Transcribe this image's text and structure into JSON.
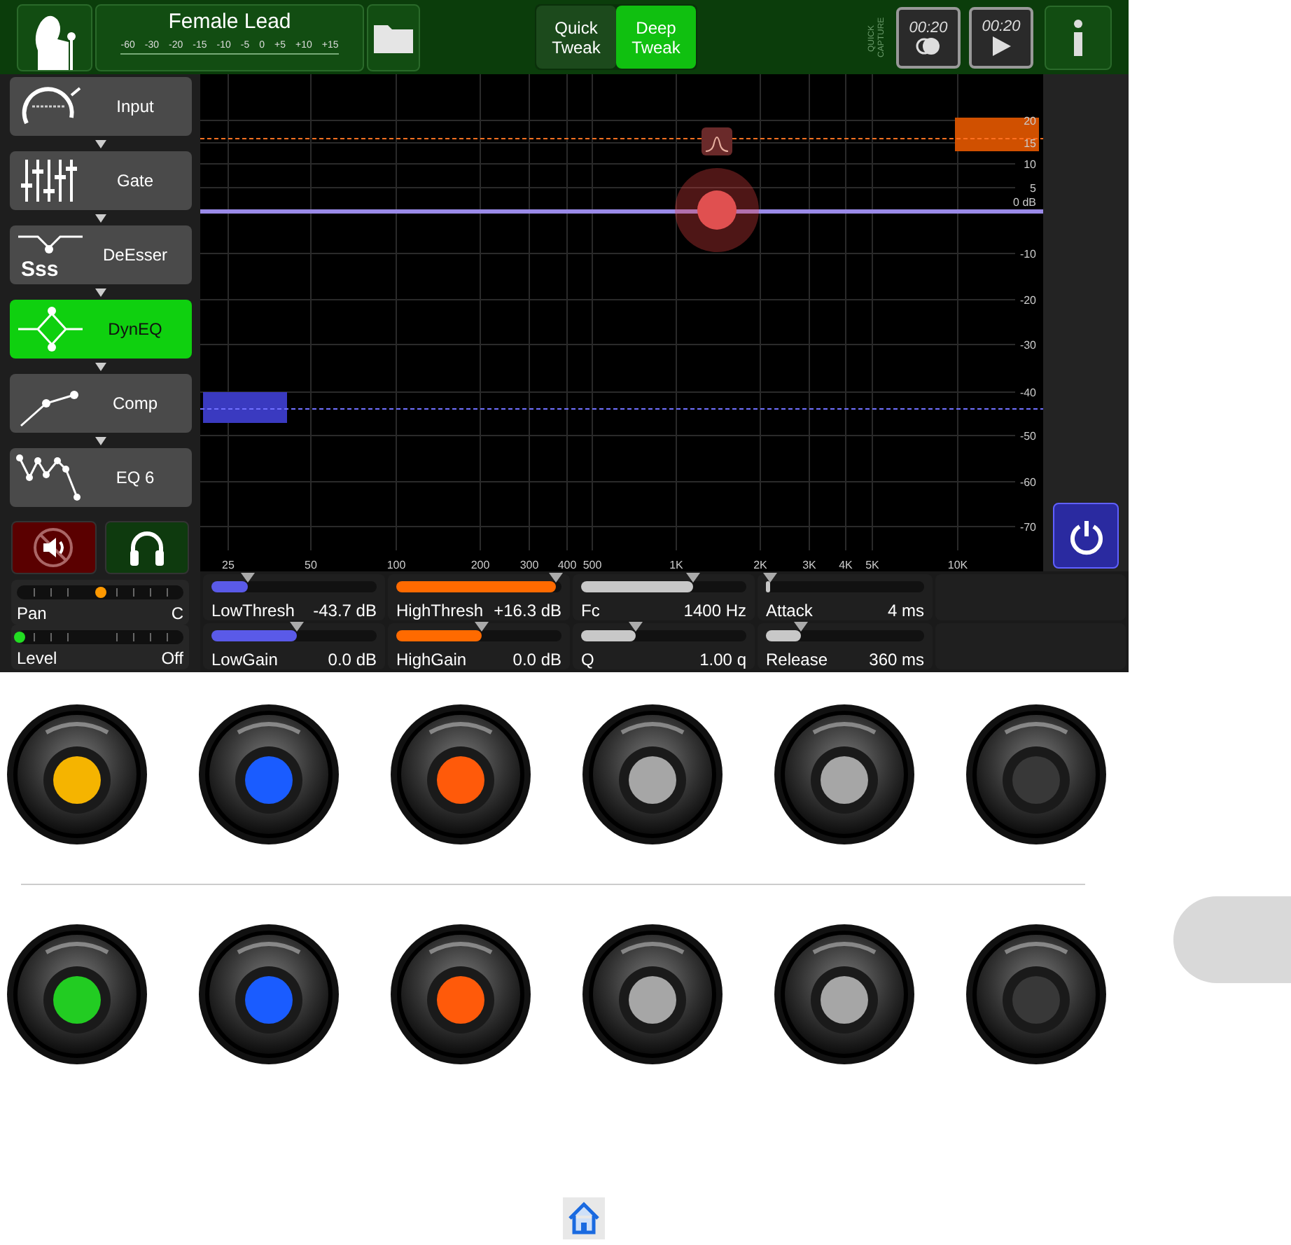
{
  "header": {
    "preset_name": "Female Lead",
    "meter_labels": [
      "-60",
      "-30",
      "-20",
      "-15",
      "-10",
      "-5",
      "0",
      "+5",
      "+10",
      "+15"
    ],
    "tweak_tabs": [
      {
        "label": "Quick Tweak",
        "selected": false
      },
      {
        "label": "Deep Tweak",
        "selected": true
      }
    ],
    "quick_capture_label": "QUICK CAPTURE",
    "capture_buttons": [
      {
        "time": "00:20",
        "kind": "record"
      },
      {
        "time": "00:20",
        "kind": "play"
      }
    ]
  },
  "sidebar": {
    "blocks": [
      {
        "label": "Input",
        "kind": "input",
        "selected": false
      },
      {
        "label": "Gate",
        "kind": "gate",
        "selected": false
      },
      {
        "label": "DeEsser",
        "kind": "deesser",
        "selected": false,
        "icon_text": "Sss"
      },
      {
        "label": "DynEQ",
        "kind": "dyneq",
        "selected": true
      },
      {
        "label": "Comp",
        "kind": "comp",
        "selected": false
      },
      {
        "label": "EQ 6",
        "kind": "eq",
        "selected": false
      }
    ],
    "mute": {
      "on": true
    },
    "pan": {
      "label": "Pan",
      "value": "C",
      "level": 0.5
    },
    "level": {
      "label": "Level",
      "value": "Off",
      "level": 0.02
    }
  },
  "graph": {
    "y_labels": [
      "20",
      "15",
      "10",
      "5",
      "0 dB",
      "-10",
      "-20",
      "-30",
      "-40",
      "-50",
      "-60",
      "-70"
    ],
    "x_labels": [
      "25",
      "50",
      "100",
      "200",
      "300",
      "400",
      "500",
      "1K",
      "2K",
      "3K",
      "4K",
      "5K",
      "10K"
    ]
  },
  "params": [
    {
      "label": "LowThresh",
      "value": "-43.7 dB",
      "level": 0.22,
      "color": "#5a5ae8"
    },
    {
      "label": "HighThresh",
      "value": "+16.3 dB",
      "level": 0.97,
      "color": "#ff6a00"
    },
    {
      "label": "Fc",
      "value": "1400 Hz",
      "level": 0.68,
      "color": "#c8c8c8"
    },
    {
      "label": "Attack",
      "value": "4 ms",
      "level": 0.03,
      "color": "#c8c8c8"
    },
    {
      "label": "LowGain",
      "value": "0.0 dB",
      "level": 0.52,
      "color": "#5a5ae8"
    },
    {
      "label": "HighGain",
      "value": "0.0 dB",
      "level": 0.52,
      "color": "#ff6a00"
    },
    {
      "label": "Q",
      "value": "1.00 q",
      "level": 0.33,
      "color": "#c8c8c8"
    },
    {
      "label": "Release",
      "value": "360 ms",
      "level": 0.22,
      "color": "#c8c8c8"
    }
  ],
  "knob_rows": [
    [
      {
        "color": "#f5b400"
      },
      {
        "color": "#1a5cff"
      },
      {
        "color": "#ff5a0a"
      },
      {
        "color": "#a6a6a6"
      },
      {
        "color": "#a6a6a6"
      },
      {
        "color": "#383838"
      }
    ],
    [
      {
        "color": "#22cc22"
      },
      {
        "color": "#1a5cff"
      },
      {
        "color": "#ff5a0a"
      },
      {
        "color": "#a6a6a6"
      },
      {
        "color": "#a6a6a6"
      },
      {
        "color": "#383838"
      }
    ]
  ]
}
